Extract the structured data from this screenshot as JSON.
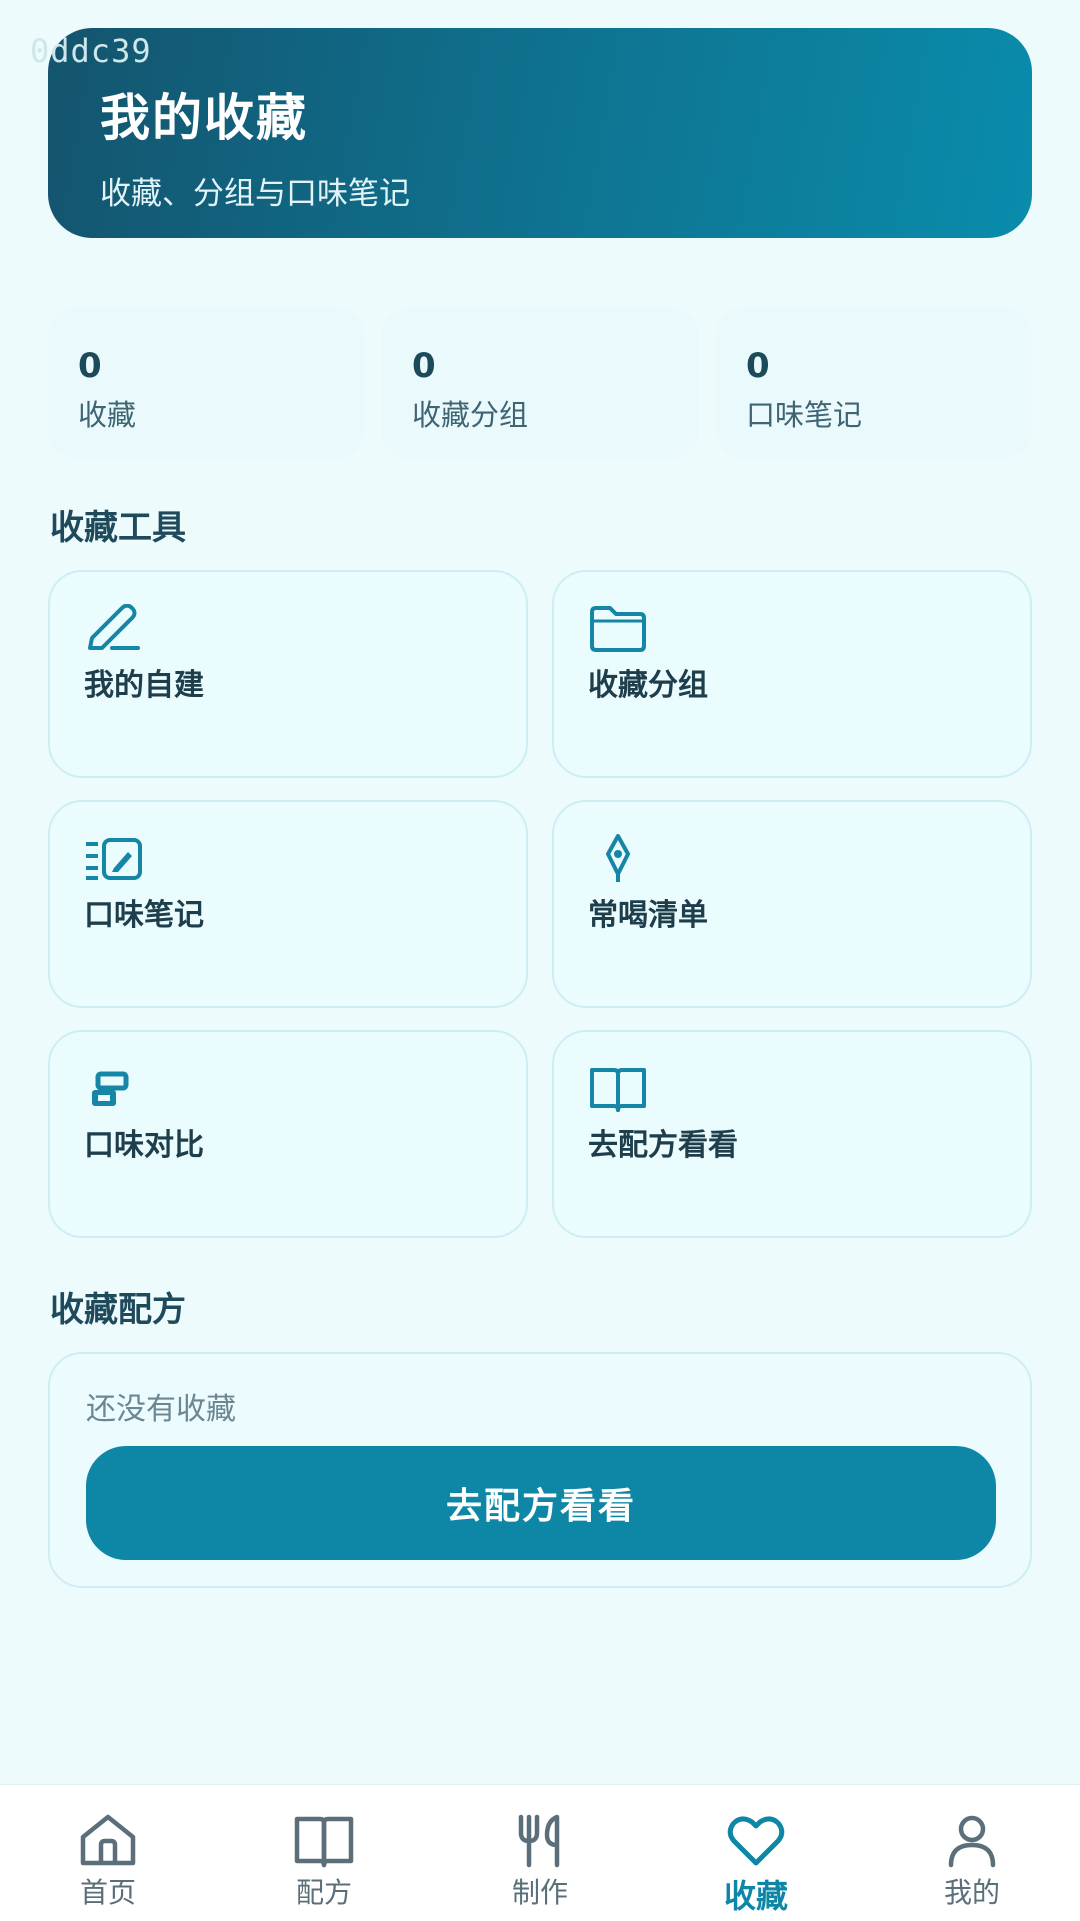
{
  "watermark": "0ddc39",
  "header": {
    "title": "我的收藏",
    "subtitle": "收藏、分组与口味笔记"
  },
  "stats": [
    {
      "value": "0",
      "label": "收藏"
    },
    {
      "value": "0",
      "label": "收藏分组"
    },
    {
      "value": "0",
      "label": "口味笔记"
    }
  ],
  "tools_section": {
    "title": "收藏工具",
    "items": [
      {
        "label": "我的自建",
        "icon": "pencil-icon"
      },
      {
        "label": "收藏分组",
        "icon": "folder-icon"
      },
      {
        "label": "口味笔记",
        "icon": "notes-icon"
      },
      {
        "label": "常喝清单",
        "icon": "cocktail-icon"
      },
      {
        "label": "口味对比",
        "icon": "compare-icon"
      },
      {
        "label": "去配方看看",
        "icon": "book-icon"
      }
    ]
  },
  "favorites_section": {
    "title": "收藏配方",
    "empty_text": "还没有收藏",
    "button_label": "去配方看看"
  },
  "tabbar": {
    "active": "收藏",
    "items": [
      {
        "label": "首页",
        "icon": "home-icon"
      },
      {
        "label": "配方",
        "icon": "book-icon"
      },
      {
        "label": "制作",
        "icon": "utensils-icon"
      },
      {
        "label": "收藏",
        "icon": "heart-icon"
      },
      {
        "label": "我的",
        "icon": "user-icon"
      }
    ]
  },
  "colors": {
    "accent": "#0e87a6",
    "header_start": "#14546e",
    "header_end": "#0a8cac",
    "background": "#eefbfc"
  }
}
